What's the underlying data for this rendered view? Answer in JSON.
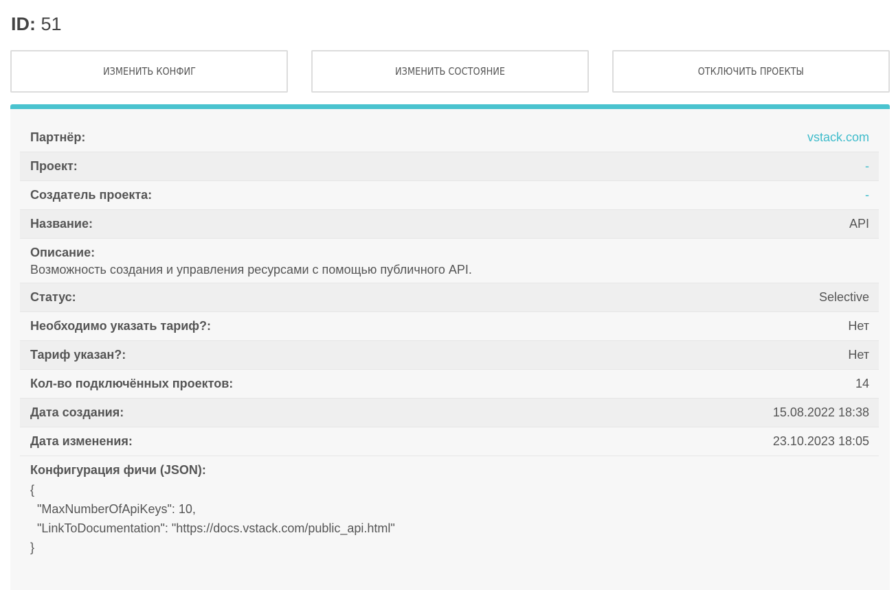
{
  "header": {
    "id_label": "ID:",
    "id_value": "51"
  },
  "actions": {
    "edit_config": "ИЗМЕНИТЬ КОНФИГ",
    "edit_state": "ИЗМЕНИТЬ СОСТОЯНИЕ",
    "disable_projects": "ОТКЛЮЧИТЬ ПРОЕКТЫ"
  },
  "details": {
    "partner": {
      "label": "Партнёр:",
      "value": "vstack.com"
    },
    "project": {
      "label": "Проект:",
      "value": "-"
    },
    "project_creator": {
      "label": "Создатель проекта:",
      "value": "-"
    },
    "name": {
      "label": "Название:",
      "value": "API"
    },
    "description": {
      "label": "Описание:",
      "value": "Возможность создания и управления ресурсами с помощью публичного API."
    },
    "status": {
      "label": "Статус:",
      "value": "Selective"
    },
    "tariff_required": {
      "label": "Необходимо указать тариф?:",
      "value": "Нет"
    },
    "tariff_set": {
      "label": "Тариф указан?:",
      "value": "Нет"
    },
    "connected_projects": {
      "label": "Кол-во подключённых проектов:",
      "value": "14"
    },
    "created_at": {
      "label": "Дата создания:",
      "value": "15.08.2022 18:38"
    },
    "updated_at": {
      "label": "Дата изменения:",
      "value": "23.10.2023 18:05"
    }
  },
  "config": {
    "label": "Конфигурация фичи (JSON):",
    "lines": [
      "{",
      "  \"MaxNumberOfApiKeys\": 10,",
      "  \"LinkToDocumentation\": \"https://docs.vstack.com/public_api.html\"",
      "}"
    ]
  },
  "colors": {
    "accent": "#4ac3cf",
    "link": "#3fbccb"
  }
}
